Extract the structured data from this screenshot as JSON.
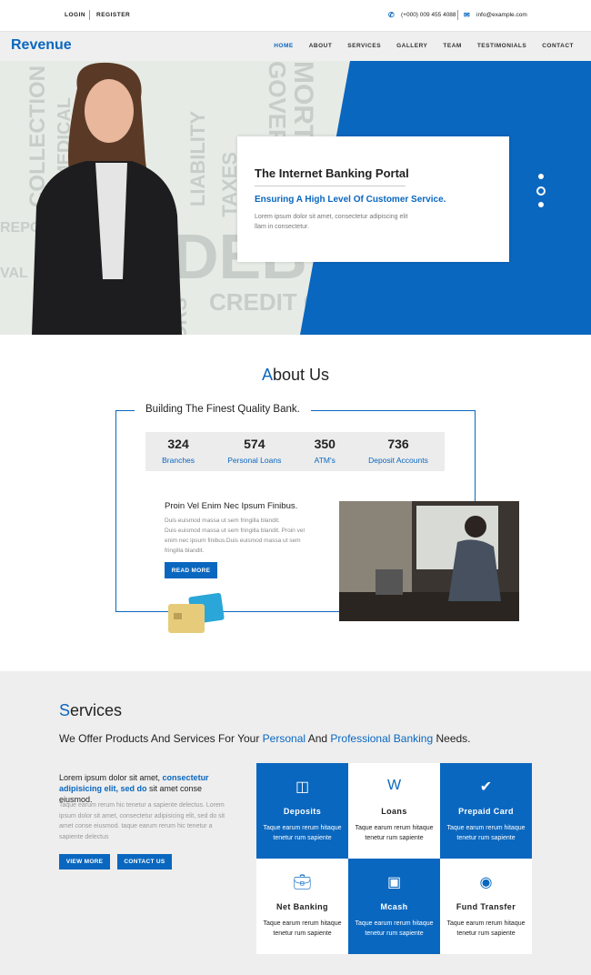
{
  "topbar": {
    "login": "LOGIN",
    "register": "REGISTER",
    "phone": "(+000) 009 455 4088",
    "email": "info@example.com"
  },
  "nav": {
    "logo": "Revenue",
    "items": [
      "HOME",
      "ABOUT",
      "SERVICES",
      "GALLERY",
      "TEAM",
      "TESTIMONIALS",
      "CONTACT"
    ],
    "active": "HOME"
  },
  "hero": {
    "title": "The Internet Banking Portal",
    "subtitle": "Ensuring A High Level Of Customer Service.",
    "text": "Lorem ipsum dolor sit amet, consectetur adipiscing elit llam in consectetur.",
    "slides": 3,
    "active_slide": 2,
    "background_words": [
      "COLLECTION",
      "MEDICAL",
      "LIABILITY",
      "TAXES",
      "CREDIT C",
      "DEBT",
      "REPO",
      "VAL",
      "ORS",
      "GOVERNMI",
      "MORTGAG"
    ]
  },
  "colors": {
    "accent": "#0a67bf",
    "services_bg": "#eeeeee"
  },
  "about": {
    "title_first": "A",
    "title_rest": "bout Us",
    "frame_title": "Building The Finest Quality Bank.",
    "stats": [
      {
        "value": "324",
        "label": "Branches"
      },
      {
        "value": "574",
        "label": "Personal Loans"
      },
      {
        "value": "350",
        "label": "ATM's"
      },
      {
        "value": "736",
        "label": "Deposit Accounts"
      }
    ],
    "heading": "Proin Vel Enim Nec Ipsum Finibus.",
    "text1": "Duis euismod massa ut sem fringilla blandit.",
    "text2": "Duis euismod massa ut sem fringilla blandit. Proin vel enim nec ipsum finibus.Duis euismod massa ut sem fringilla blandit.",
    "button": "READ MORE"
  },
  "services": {
    "title_first": "S",
    "title_rest": "ervices",
    "sub_a": "We Offer Products And Services For Your ",
    "sub_b": "Personal",
    "sub_c": " And ",
    "sub_d": "Professional Banking",
    "sub_e": " Needs.",
    "lead_a": "Lorem ipsum dolor sit amet, ",
    "lead_b": "consectetur adipisicing elit, sed do",
    "lead_c": " sit amet conse eiusmod.",
    "text": "Taque earum rerum hic tenetur a sapiente delectus. Lorem ipsum dolor sit amet, consectetur adipisicing elit, sed do sit amet conse eiusmod. taque earum rerum hic tenetur a sapiente delectus",
    "view_more": "VIEW MORE",
    "contact_us": "CONTACT US",
    "items": [
      {
        "title": "Deposits",
        "icon": "diners-card-icon",
        "text": "Taque earum rerum hitaque tenetur rum sapiente",
        "blue": true
      },
      {
        "title": "Loans",
        "icon": "wallet-icon",
        "text": "Taque earum rerum hitaque tenetur rum sapiente",
        "blue": false
      },
      {
        "title": "Prepaid Card",
        "icon": "check-icon",
        "text": "Taque earum rerum hitaque tenetur rum sapiente",
        "blue": true
      },
      {
        "title": "Net Banking",
        "icon": "briefcase-icon",
        "text": "Taque earum rerum hitaque tenetur rum sapiente",
        "blue": false
      },
      {
        "title": "Mcash",
        "icon": "inbox-icon",
        "text": "Taque earum rerum hitaque tenetur rum sapiente",
        "blue": true
      },
      {
        "title": "Fund Transfer",
        "icon": "mastercard-icon",
        "text": "Taque earum rerum hitaque tenetur rum sapiente",
        "blue": false
      }
    ]
  }
}
